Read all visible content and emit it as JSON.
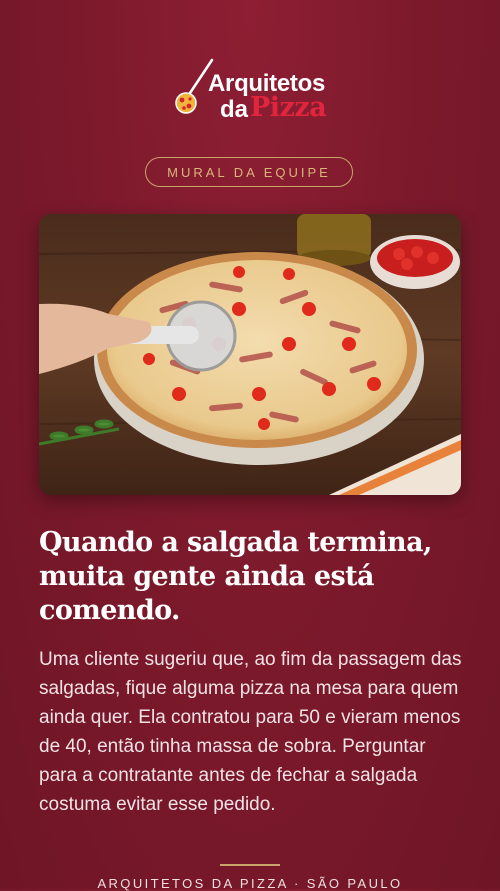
{
  "brand": {
    "line1": "Arquitetos",
    "line2_prefix": "da",
    "line2_accent": "Pizza",
    "accent_color": "#e0253d"
  },
  "pill": {
    "label": "MURAL DA EQUIPE"
  },
  "photo": {
    "icon": "pizza-photo"
  },
  "post": {
    "headline": "Quando a salgada termina, muita gente ainda está comendo.",
    "body": "Uma cliente sugeriu que, ao fim da passagem das salgadas, fique alguma pizza na mesa para quem ainda quer. Ela contratou para 50 e vieram menos de 40, então tinha massa de sobra. Perguntar para a contratante antes de fechar a salgada costuma evitar esse pedido."
  },
  "footer": {
    "text": "ARQUITETOS DA PIZZA · SÃO PAULO"
  },
  "colors": {
    "background": "#7d1a2c",
    "gold": "#c9a46a"
  }
}
